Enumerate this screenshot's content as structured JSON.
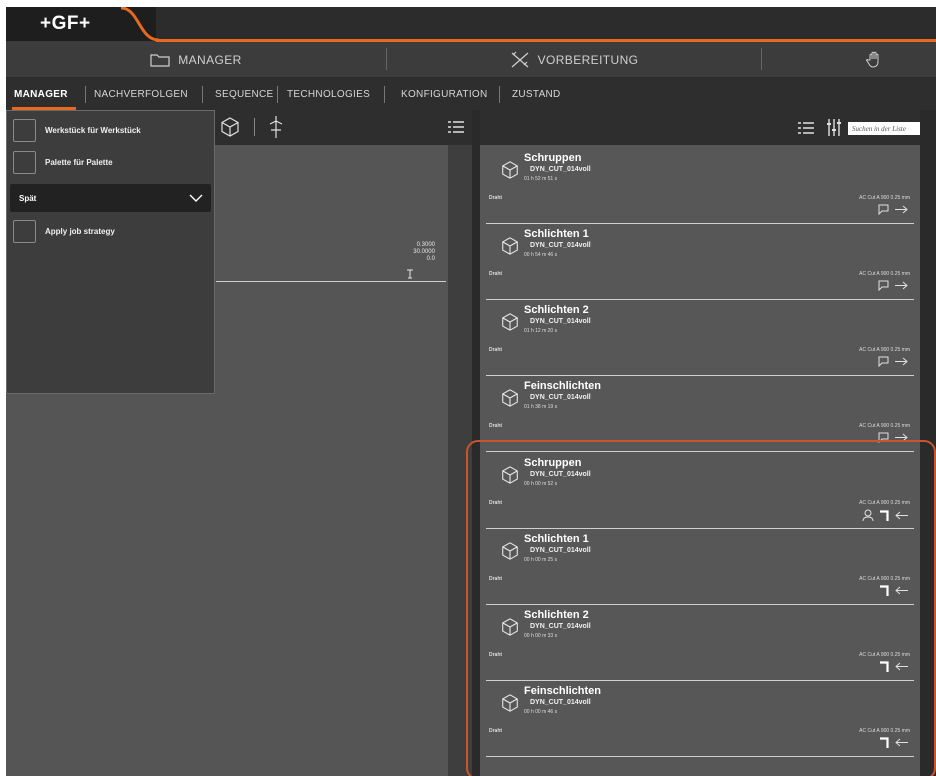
{
  "brand": {
    "logo": "+GF+"
  },
  "modules": [
    {
      "label": "MANAGER",
      "icon": "folder-icon"
    },
    {
      "label": "VORBEREITUNG",
      "icon": "tools-icon"
    },
    {
      "label": "",
      "icon": "hand-icon"
    }
  ],
  "tabs": [
    {
      "label": "MANAGER",
      "active": true
    },
    {
      "label": "NACHVERFOLGEN"
    },
    {
      "label": "SEQUENCE"
    },
    {
      "label": "TECHNOLOGIES"
    },
    {
      "label": "KONFIGURATION"
    },
    {
      "label": "ZUSTAND"
    }
  ],
  "menu": {
    "options": [
      "Werkstück für Werkstück",
      "Palette für Palette"
    ],
    "select_value": "Spät",
    "apply_label": "Apply job strategy"
  },
  "viewer": {
    "values": [
      "0.3000",
      "30.0000",
      "0.0"
    ]
  },
  "search": {
    "placeholder": "Suchen in der Liste"
  },
  "cards": [
    {
      "title": "Schruppen",
      "program": "DYN_CUT_014voll",
      "time": "01 h 52 m 51 s",
      "material": "Draht",
      "technology": "AC Cut A 900 0.25 mm",
      "icons": [
        "comment-icon",
        "arrow-right-icon"
      ]
    },
    {
      "title": "Schlichten 1",
      "program": "DYN_CUT_014voll",
      "time": "00 h 54 m 46 s",
      "material": "Draht",
      "technology": "AC Cut A 900 0.25 mm",
      "icons": [
        "comment-icon",
        "arrow-right-icon"
      ]
    },
    {
      "title": "Schlichten 2",
      "program": "DYN_CUT_014voll",
      "time": "01 h 12 m 20 s",
      "material": "Draht",
      "technology": "AC Cut A 900 0.25 mm",
      "icons": [
        "comment-icon",
        "arrow-right-icon"
      ]
    },
    {
      "title": "Feinschlichten",
      "program": "DYN_CUT_014voll",
      "time": "01 h 38 m 19 s",
      "material": "Draht",
      "technology": "AC Cut A 900 0.25 mm",
      "icons": [
        "comment-icon",
        "arrow-right-icon"
      ]
    },
    {
      "title": "Schruppen",
      "program": "DYN_CUT_014voll",
      "time": "00 h 00 m 52 s",
      "material": "Draht",
      "technology": "AC Cut A 900 0.25 mm",
      "icons": [
        "user-icon",
        "corner-icon",
        "arrow-left-icon"
      ]
    },
    {
      "title": "Schlichten 1",
      "program": "DYN_CUT_014voll",
      "time": "00 h 00 m 25 s",
      "material": "Draht",
      "technology": "AC Cut A 900 0.25 mm",
      "icons": [
        "corner-icon",
        "arrow-left-icon"
      ]
    },
    {
      "title": "Schlichten 2",
      "program": "DYN_CUT_014voll",
      "time": "00 h 00 m 33 s",
      "material": "Draht",
      "technology": "AC Cut A 900 0.25 mm",
      "icons": [
        "corner-icon",
        "arrow-left-icon"
      ]
    },
    {
      "title": "Feinschlichten",
      "program": "DYN_CUT_014voll",
      "time": "00 h 00 m 46 s",
      "material": "Draht",
      "technology": "AC Cut A 900 0.25 mm",
      "icons": [
        "corner-icon",
        "arrow-left-icon"
      ]
    }
  ],
  "colors": {
    "accent": "#e86a1e",
    "highlight": "#c8552e",
    "card_bg": "#575757"
  }
}
